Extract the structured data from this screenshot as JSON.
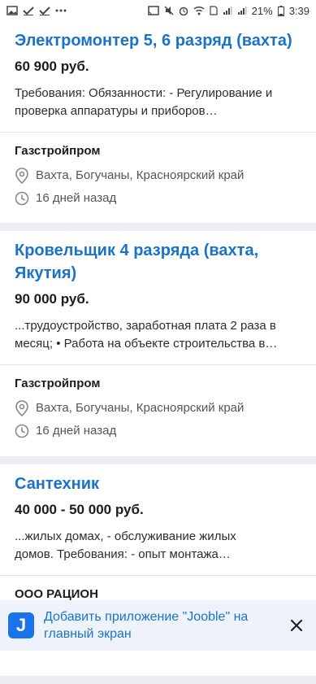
{
  "status_bar": {
    "battery": "21%",
    "time": "3:39",
    "left_icons": [
      "image-icon",
      "check-icon",
      "check-icon",
      "more-dots-icon"
    ],
    "right_icons": [
      "cast-icon",
      "mute-icon",
      "alarm-icon",
      "wifi-icon",
      "sim-icon",
      "signal-icon",
      "signal-icon"
    ]
  },
  "jobs": [
    {
      "title": "Электромонтер 5, 6 разряд (вахта)",
      "salary": "60 900 руб.",
      "description_lines": [
        "Требования: Обязанности: - Регулирование и",
        "проверка аппаратуры и приборов…"
      ],
      "company": "Газстройпром",
      "location": "Вахта, Богучаны, Красноярский край",
      "posted": "16 дней назад"
    },
    {
      "title_lines": [
        "Кровельщик 4 разряда (вахта,",
        "Якутия)"
      ],
      "salary": "90 000 руб.",
      "description_lines": [
        "...трудоустройство, заработная плата 2 раза в",
        "месяц; • Работа на объекте строительства в…"
      ],
      "company": "Газстройпром",
      "location": "Вахта, Богучаны, Красноярский край",
      "posted": "16 дней назад"
    },
    {
      "title": "Сантехник",
      "salary": "40 000 - 50 000 руб.",
      "description_lines": [
        "...жилых домах, - обслуживание жилых",
        "домов. Требования: - опыт монтажа…"
      ],
      "company": "ООО РАЦИОН"
    }
  ],
  "banner": {
    "icon_letter": "J",
    "text_lines": [
      "Добавить приложение \"Jooble\" на",
      "главный экран"
    ]
  }
}
